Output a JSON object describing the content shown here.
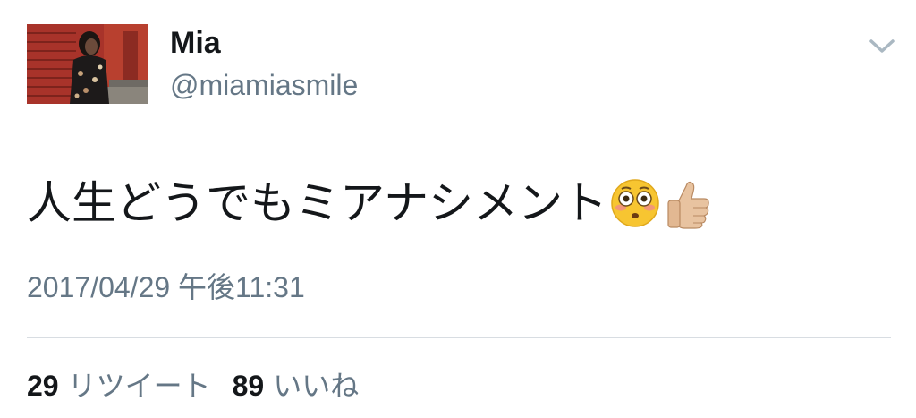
{
  "author": {
    "display_name": "Mia",
    "handle": "@miamiasmile",
    "avatar_icon": "profile-photo"
  },
  "tweet": {
    "text": "人生どうでもミアナシメント",
    "emojis": [
      "flushed-face-icon",
      "thumbs-up-icon"
    ],
    "timestamp": "2017/04/29 午後11:31"
  },
  "stats": {
    "retweet_count": "29",
    "retweet_label": "リツイート",
    "like_count": "89",
    "like_label": "いいね"
  },
  "colors": {
    "primary_text": "#14171a",
    "secondary_text": "#657786",
    "divider": "#d8dde2",
    "chevron": "#aab8c2"
  }
}
